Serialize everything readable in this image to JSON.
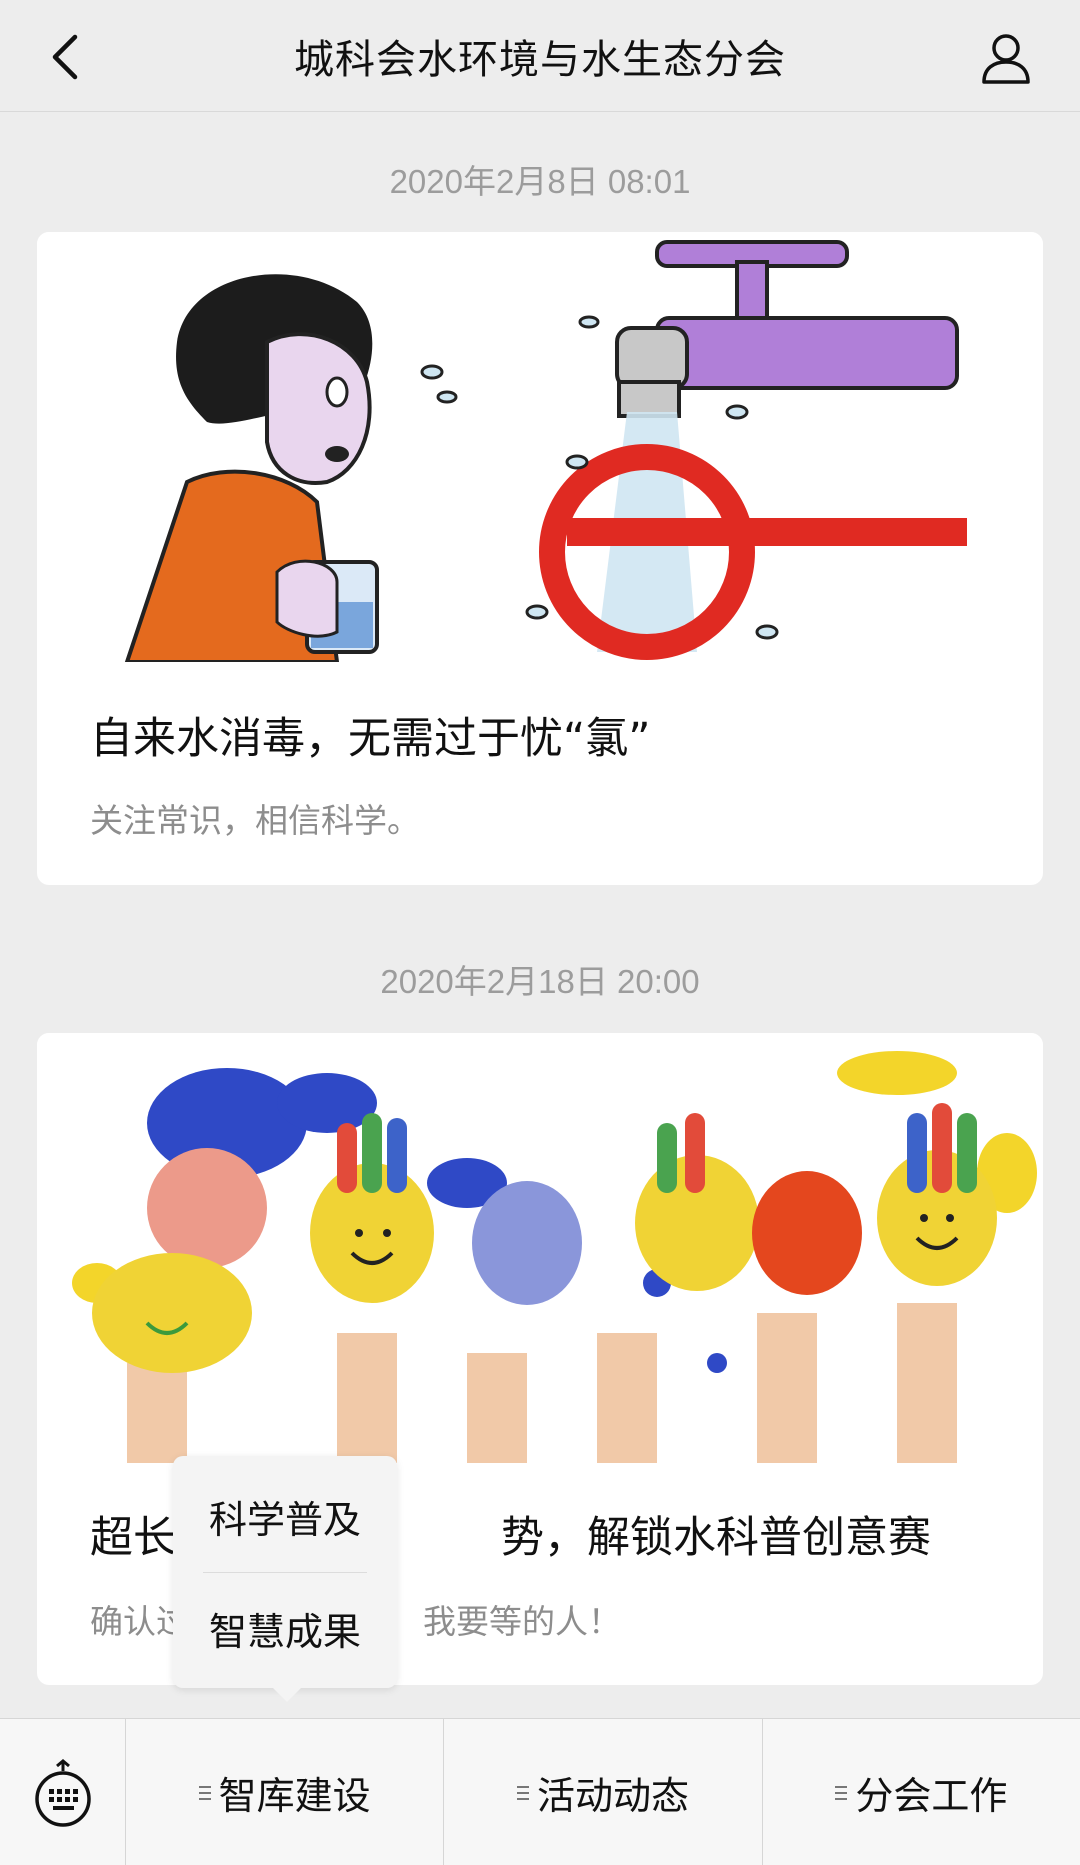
{
  "header": {
    "title": "城科会水环境与水生态分会",
    "back_icon": "chevron-left-icon",
    "profile_icon": "person-icon"
  },
  "messages": [
    {
      "timestamp": "2020年2月8日 08:01",
      "title": "自来水消毒，无需过于忧“氯”",
      "description": "关注常识，相信科学。",
      "image": "cartoon-woman-tap-water"
    },
    {
      "timestamp": "2020年2月18日 20:00",
      "title": "超长假期不再寂寞，解锁水科普创意赛",
      "description": "确认过眼神，你就是我要等的人！",
      "image": "painted-hands"
    }
  ],
  "visible_text": {
    "card2_title_left": "超长",
    "card2_title_right": "势，解锁水科普创意赛",
    "card2_desc_left": "确认过",
    "card2_desc_right": "我要等的人！"
  },
  "submenu": {
    "items": [
      "科学普及",
      "智慧成果"
    ]
  },
  "menubar": {
    "keyboard_icon": "keyboard-icon",
    "items": [
      "智库建设",
      "活动动态",
      "分会工作"
    ]
  },
  "colors": {
    "background": "#ededed",
    "card": "#ffffff",
    "timestamp": "#9c9c9c",
    "description": "#8d8d8d"
  }
}
